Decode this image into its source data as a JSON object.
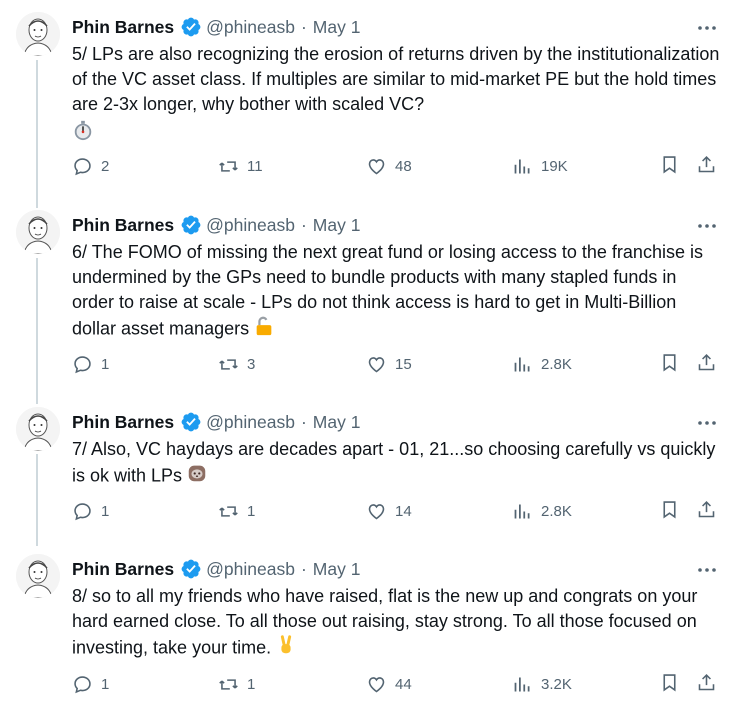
{
  "tweets": [
    {
      "name": "Phin Barnes",
      "handle": "@phineasb",
      "date": "May 1",
      "text": "5/ LPs are also recognizing the erosion of returns driven by the institutionalization of the VC asset class. If multiples are similar to mid-market PE but the hold times are 2-3x longer, why bother with scaled VC?",
      "emoji": "stopwatch-icon",
      "replies": "2",
      "reposts": "11",
      "likes": "48",
      "views": "19K"
    },
    {
      "name": "Phin Barnes",
      "handle": "@phineasb",
      "date": "May 1",
      "text": "6/ The FOMO of missing the next great fund or losing access to the franchise is undermined by the GPs need to bundle products with many stapled funds in order to raise at scale - LPs do not think access is hard to get in Multi-Billion dollar asset managers",
      "emoji": "unlocked-icon",
      "replies": "1",
      "reposts": "3",
      "likes": "15",
      "views": "2.8K"
    },
    {
      "name": "Phin Barnes",
      "handle": "@phineasb",
      "date": "May 1",
      "text": "7/ Also, VC haydays are decades apart - 01, 21...so choosing carefully vs quickly is ok with LPs",
      "emoji": "sloth-icon",
      "replies": "1",
      "reposts": "1",
      "likes": "14",
      "views": "2.8K"
    },
    {
      "name": "Phin Barnes",
      "handle": "@phineasb",
      "date": "May 1",
      "text": "8/ so to all my friends who have raised, flat is the new up and congrats on your hard earned close. To all those out raising, stay strong. To all those focused on investing, take your time.",
      "emoji": "victory-hand-icon",
      "replies": "1",
      "reposts": "1",
      "likes": "44",
      "views": "3.2K"
    }
  ],
  "colors": {
    "text": "#0f1419",
    "secondary": "#536471",
    "verified": "#1d9bf0",
    "thread_line": "#cfd9de"
  }
}
